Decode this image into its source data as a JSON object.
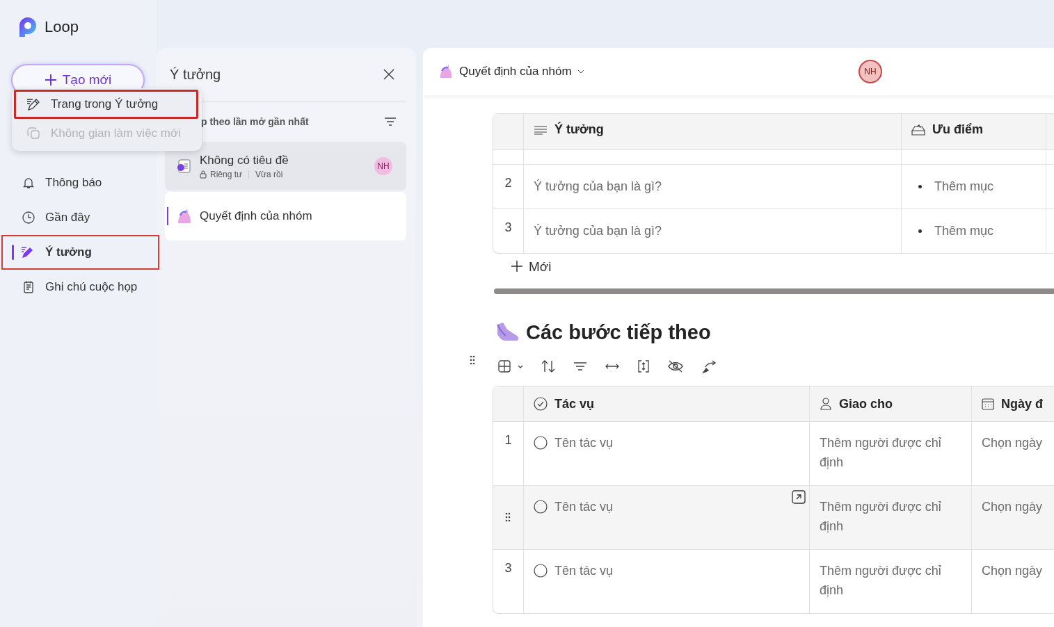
{
  "app": {
    "name": "Loop"
  },
  "new_button": {
    "label": "Tạo mới"
  },
  "new_menu": [
    {
      "label": "Trang trong Ý tưởng",
      "disabled": false,
      "highlighted": true
    },
    {
      "label": "Không gian làm việc mới",
      "disabled": true,
      "highlighted": false
    }
  ],
  "nav": [
    {
      "label": "Thông báo",
      "kind": "bell",
      "selected": false
    },
    {
      "label": "Gần đây",
      "kind": "clock",
      "selected": false
    },
    {
      "label": "Ý tưởng",
      "kind": "pen",
      "selected": true
    },
    {
      "label": "Ghi chú cuộc họp",
      "kind": "notes",
      "selected": false
    }
  ],
  "panel": {
    "title": "Ý tưởng",
    "sort_label": "p theo lần mở gần nhất",
    "pages": [
      {
        "title": "Không có tiêu đề",
        "privacy": "Riêng tư",
        "time": "Vừa rồi",
        "avatar": "NH",
        "kind": "doc",
        "selected": true
      },
      {
        "title": "Quyết định của nhóm",
        "kind": "unicorn",
        "selected": false,
        "active": true
      }
    ]
  },
  "page": {
    "title": "Quyết định của nhóm",
    "avatar": "NH",
    "ideas_table": {
      "columns": [
        {
          "label": "Ý tưởng",
          "kind": "lines"
        },
        {
          "label": "Ưu điểm",
          "kind": "tray"
        }
      ],
      "rows": [
        {
          "num": "2",
          "idea": "Ý tưởng của bạn là gì?",
          "pro": "Thêm mục"
        },
        {
          "num": "3",
          "idea": "Ý tưởng của bạn là gì?",
          "pro": "Thêm mục"
        }
      ],
      "new_label": "Mới"
    },
    "section_title": "Các bước tiếp theo",
    "tasks_table": {
      "columns": [
        {
          "label": "Tác vụ",
          "kind": "check"
        },
        {
          "label": "Giao cho",
          "kind": "person"
        },
        {
          "label": "Ngày đ",
          "kind": "calendar"
        }
      ],
      "rows": [
        {
          "num": "1",
          "task": "Tên tác vụ",
          "assignee": "Thêm người được chỉ định",
          "date": "Chọn ngày",
          "hovered": false
        },
        {
          "num": "",
          "task": "Tên tác vụ",
          "assignee": "Thêm người được chỉ định",
          "date": "Chọn ngày",
          "hovered": true
        },
        {
          "num": "3",
          "task": "Tên tác vụ",
          "assignee": "Thêm người được chỉ định",
          "date": "Chọn ngày",
          "hovered": false
        }
      ]
    }
  }
}
